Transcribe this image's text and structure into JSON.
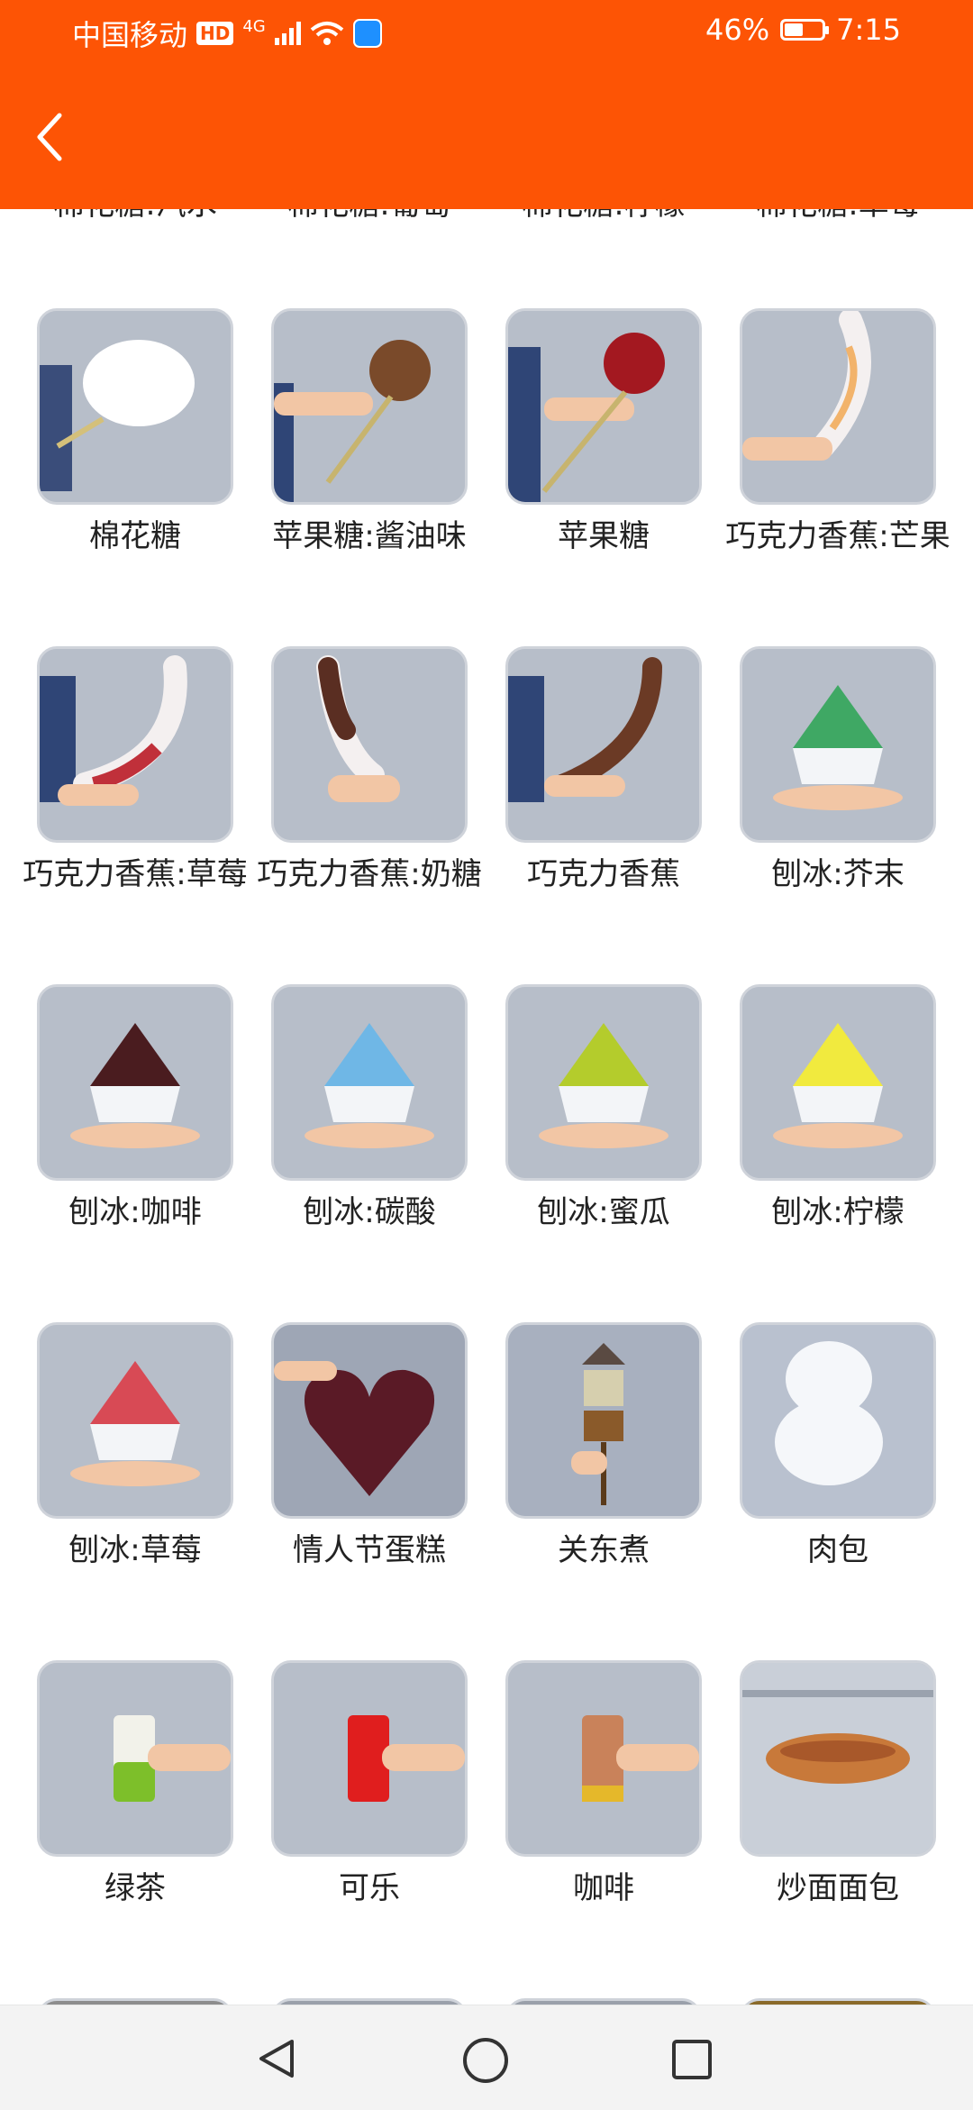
{
  "status_bar": {
    "carrier": "中国移动",
    "hd_badge": "HD",
    "network": "4G",
    "battery": "46%",
    "time": "7:15"
  },
  "header": {
    "back_icon": "chevron-left-icon"
  },
  "colors": {
    "header_bg": "#fd5405",
    "status_text": "#ffffff",
    "thumb_border": "#cfd3da"
  },
  "partial_top_labels": [
    "棉花糖:汽水",
    "棉花糖:葡萄",
    "棉花糖:柠檬",
    "棉花糖:草莓"
  ],
  "items": [
    {
      "label": "棉花糖"
    },
    {
      "label": "苹果糖:酱油味"
    },
    {
      "label": "苹果糖"
    },
    {
      "label": "巧克力香蕉:芒果"
    },
    {
      "label": "巧克力香蕉:草莓"
    },
    {
      "label": "巧克力香蕉:奶糖"
    },
    {
      "label": "巧克力香蕉"
    },
    {
      "label": "刨冰:芥末"
    },
    {
      "label": "刨冰:咖啡"
    },
    {
      "label": "刨冰:碳酸"
    },
    {
      "label": "刨冰:蜜瓜"
    },
    {
      "label": "刨冰:柠檬"
    },
    {
      "label": "刨冰:草莓"
    },
    {
      "label": "情人节蛋糕"
    },
    {
      "label": "关东煮"
    },
    {
      "label": "肉包"
    },
    {
      "label": "绿茶"
    },
    {
      "label": "可乐"
    },
    {
      "label": "咖啡"
    },
    {
      "label": "炒面面包"
    }
  ],
  "nav_bar": {
    "back": "triangle-back-icon",
    "home": "circle-home-icon",
    "recents": "square-recents-icon"
  }
}
